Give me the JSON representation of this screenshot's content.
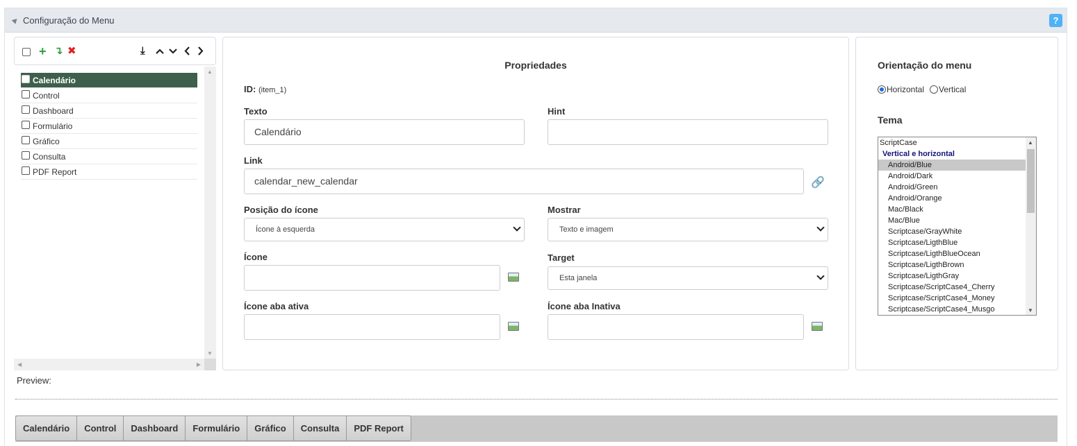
{
  "section": {
    "title": "Configuração do Menu",
    "help": "?"
  },
  "tree": {
    "items": [
      {
        "label": "Calendário",
        "selected": true
      },
      {
        "label": "Control",
        "selected": false
      },
      {
        "label": "Dashboard",
        "selected": false
      },
      {
        "label": "Formulário",
        "selected": false
      },
      {
        "label": "Gráfico",
        "selected": false
      },
      {
        "label": "Consulta",
        "selected": false
      },
      {
        "label": "PDF Report",
        "selected": false
      }
    ]
  },
  "props": {
    "title": "Propriedades",
    "id_label": "ID:",
    "id_value": "(item_1)",
    "texto_label": "Texto",
    "texto_value": "Calendário",
    "hint_label": "Hint",
    "hint_value": "",
    "link_label": "Link",
    "link_value": "calendar_new_calendar",
    "posicao_label": "Posição do ícone",
    "posicao_value": "Ícone à esquerda",
    "mostrar_label": "Mostrar",
    "mostrar_value": "Texto e imagem",
    "icone_label": "Ícone",
    "icone_value": "",
    "target_label": "Target",
    "target_value": "Esta janela",
    "icone_ativa_label": "Ícone aba ativa",
    "icone_ativa_value": "",
    "icone_inativa_label": "Ícone aba Inativa",
    "icone_inativa_value": ""
  },
  "orientation": {
    "title": "Orientação do menu",
    "horizontal": "Horizontal",
    "vertical": "Vertical",
    "selected": "Horizontal"
  },
  "theme": {
    "title": "Tema",
    "options": [
      "ScriptCase",
      "Vertical e horizontal",
      "Android/Blue",
      "Android/Dark",
      "Android/Green",
      "Android/Orange",
      "Mac/Black",
      "Mac/Blue",
      "Scriptcase/GrayWhite",
      "Scriptcase/LigthBlue",
      "Scriptcase/LigthBlueOcean",
      "Scriptcase/LigthBrown",
      "Scriptcase/LigthGray",
      "Scriptcase/ScriptCase4_Cherry",
      "Scriptcase/ScriptCase4_Money",
      "Scriptcase/ScriptCase4_Musgo"
    ],
    "selected": "Android/Blue"
  },
  "preview": {
    "label": "Preview:",
    "items": [
      "Calendário",
      "Control",
      "Dashboard",
      "Formulário",
      "Gráfico",
      "Consulta",
      "PDF Report"
    ]
  },
  "colors": {
    "selected_tree": "#3d5f4c",
    "help": "#4fb3f5",
    "add_icon": "#2ea043",
    "delete_icon": "#e02020"
  }
}
